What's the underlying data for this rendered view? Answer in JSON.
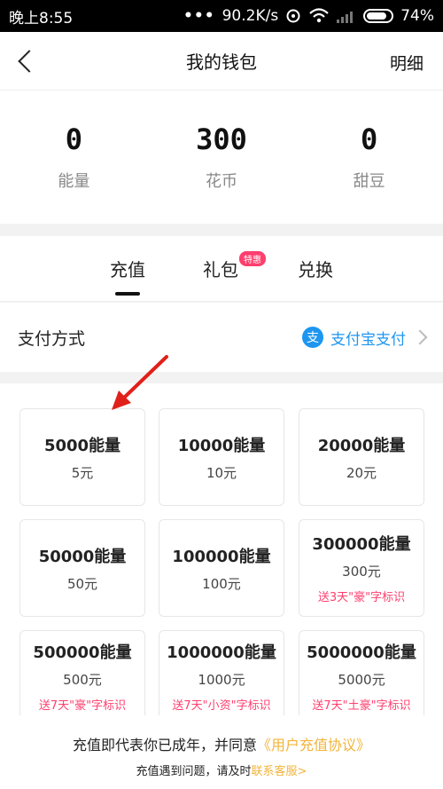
{
  "statusbar": {
    "time": "晚上8:55",
    "dots": "•••",
    "speed": "90.2K/s",
    "battery": "74%"
  },
  "nav": {
    "title": "我的钱包",
    "detail": "明细"
  },
  "balances": [
    {
      "value": "0",
      "label": "能量"
    },
    {
      "value": "300",
      "label": "花币"
    },
    {
      "value": "0",
      "label": "甜豆"
    }
  ],
  "tabs": {
    "recharge": "充值",
    "gift": "礼包",
    "gift_badge": "特惠",
    "exchange": "兑换"
  },
  "payment": {
    "label": "支付方式",
    "icon_glyph": "支",
    "method": "支付宝支付"
  },
  "packs": [
    {
      "amount": "5000能量",
      "price": "5元",
      "bonus": ""
    },
    {
      "amount": "10000能量",
      "price": "10元",
      "bonus": ""
    },
    {
      "amount": "20000能量",
      "price": "20元",
      "bonus": ""
    },
    {
      "amount": "50000能量",
      "price": "50元",
      "bonus": ""
    },
    {
      "amount": "100000能量",
      "price": "100元",
      "bonus": ""
    },
    {
      "amount": "300000能量",
      "price": "300元",
      "bonus": "送3天\"豪\"字标识"
    },
    {
      "amount": "500000能量",
      "price": "500元",
      "bonus": "送7天\"豪\"字标识"
    },
    {
      "amount": "1000000能量",
      "price": "1000元",
      "bonus": "送7天\"小资\"字标识"
    },
    {
      "amount": "5000000能量",
      "price": "5000元",
      "bonus": "送7天\"土豪\"字标识"
    }
  ],
  "footer": {
    "line1_prefix": "充值即代表你已成年，并同意",
    "line1_link": "《用户充值协议》",
    "line2_prefix": "充值遇到问题，请及时",
    "line2_link": "联系客服>"
  },
  "colors": {
    "accent": "#1e96f0",
    "badge": "#ff3f6e",
    "link": "#f2b43b",
    "arrow": "#e0201a"
  }
}
